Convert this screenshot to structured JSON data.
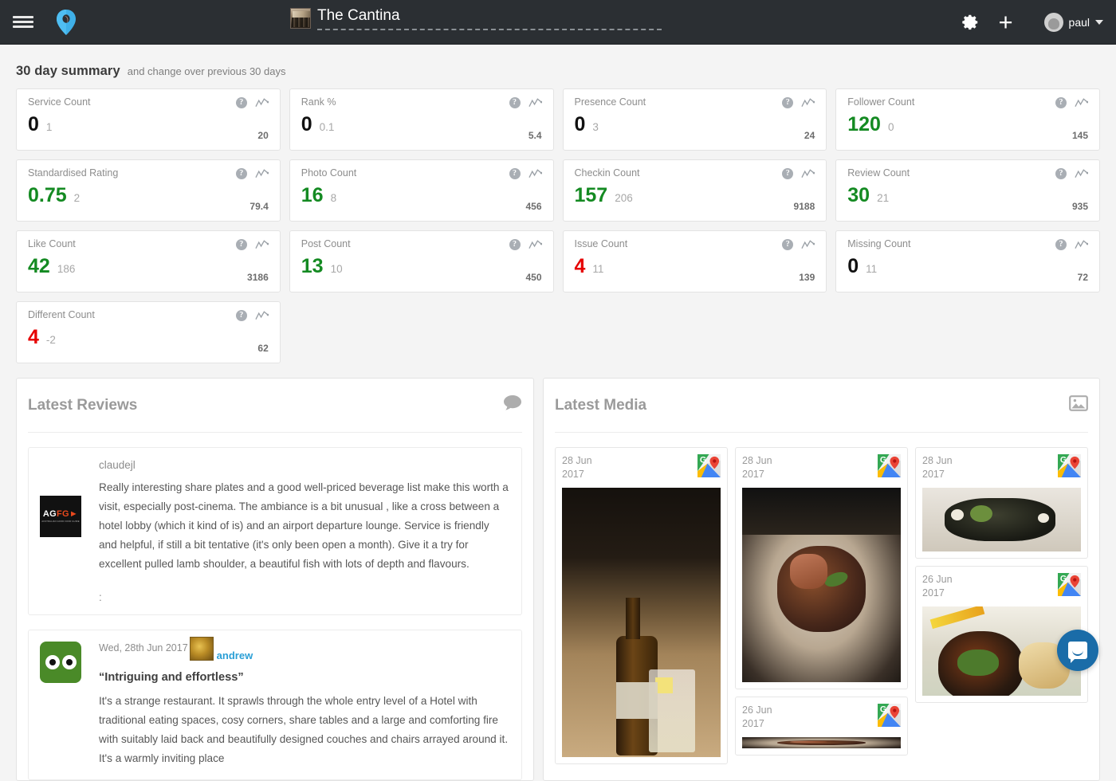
{
  "topbar": {
    "menu_icon": "hamburger-icon",
    "brand_icon": "map-pin-logo",
    "title": "The Cantina",
    "gear_icon": "gear-icon",
    "add_icon": "plus-icon",
    "user_name": "paul",
    "caret_icon": "chevron-down-icon"
  },
  "summary": {
    "heading": "30 day summary",
    "subheading": "and change over previous 30 days",
    "help_icon": "help-circle-icon",
    "trend_icon": "line-chart-icon",
    "cards": [
      {
        "label": "Service Count",
        "value": "0",
        "color": "black",
        "delta": "1",
        "total": "20"
      },
      {
        "label": "Rank %",
        "value": "0",
        "color": "black",
        "delta": "0.1",
        "total": "5.4"
      },
      {
        "label": "Presence Count",
        "value": "0",
        "color": "black",
        "delta": "3",
        "total": "24"
      },
      {
        "label": "Follower Count",
        "value": "120",
        "color": "green",
        "delta": "0",
        "total": "145"
      },
      {
        "label": "Standardised Rating",
        "value": "0.75",
        "color": "green",
        "delta": "2",
        "total": "79.4"
      },
      {
        "label": "Photo Count",
        "value": "16",
        "color": "green",
        "delta": "8",
        "total": "456"
      },
      {
        "label": "Checkin Count",
        "value": "157",
        "color": "green",
        "delta": "206",
        "total": "9188"
      },
      {
        "label": "Review Count",
        "value": "30",
        "color": "green",
        "delta": "21",
        "total": "935"
      },
      {
        "label": "Like Count",
        "value": "42",
        "color": "green",
        "delta": "186",
        "total": "3186"
      },
      {
        "label": "Post Count",
        "value": "13",
        "color": "green",
        "delta": "10",
        "total": "450"
      },
      {
        "label": "Issue Count",
        "value": "4",
        "color": "red",
        "delta": "11",
        "total": "139"
      },
      {
        "label": "Missing Count",
        "value": "0",
        "color": "black",
        "delta": "11",
        "total": "72"
      },
      {
        "label": "Different Count",
        "value": "4",
        "color": "red",
        "delta": "-2",
        "total": "62"
      }
    ]
  },
  "reviews_panel": {
    "title": "Latest Reviews",
    "icon": "comment-bubble-icon",
    "items": [
      {
        "source_logo": "agfg-logo",
        "author": "claudejl",
        "text": "Really interesting share plates and a good well-priced beverage list make this worth a visit, especially post-cinema. The ambiance is a bit unusual , like a cross between a hotel lobby (which it kind of is) and an airport departure lounge. Service is friendly and helpful, if still a bit tentative (it's only been open a month). Give it a try for excellent pulled lamb shoulder, a beautiful fish with lots of depth and flavours.",
        "trailing": ":"
      },
      {
        "source_logo": "tripadvisor-logo",
        "date": "Wed, 28th Jun 2017",
        "author": "andrew",
        "quote": "“Intriguing and effortless”",
        "text": "It's a strange restaurant. It sprawls through the whole entry level of a Hotel with traditional eating spaces, cosy corners, share tables and a large and comforting fire with suitably laid back and beautifully designed couches and chairs arrayed around it. It's a warmly inviting place"
      }
    ]
  },
  "media_panel": {
    "title": "Latest Media",
    "icon": "image-icon",
    "columns": [
      {
        "items": [
          {
            "date": "28 Jun\n2017",
            "source": "google-maps-icon",
            "photo": "bottle-and-glass-on-table"
          }
        ]
      },
      {
        "items": [
          {
            "date": "28 Jun\n2017",
            "source": "google-maps-icon",
            "photo": "plated-meat-dish"
          },
          {
            "date": "26 Jun\n2017",
            "source": "google-maps-icon",
            "photo": "partial-dish"
          }
        ]
      },
      {
        "items": [
          {
            "date": "28 Jun\n2017",
            "source": "google-maps-icon",
            "photo": "dark-plate-with-greens"
          },
          {
            "date": "26 Jun\n2017",
            "source": "google-maps-icon",
            "photo": "skillet-with-bread"
          }
        ]
      }
    ]
  },
  "chat": {
    "icon": "chat-bubble-icon"
  },
  "colors": {
    "topbar_bg": "#2b2f33",
    "page_bg": "#f4f4f4",
    "positive": "#148a22",
    "negative": "#e60000",
    "neutral": "#111111",
    "brand_blue": "#3fb0e8",
    "link_blue": "#2a9fd6",
    "chat_blue": "#1a6ca8"
  }
}
